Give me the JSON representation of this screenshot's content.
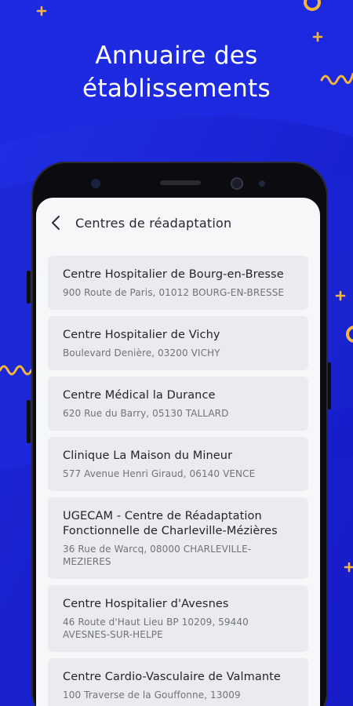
{
  "headline": {
    "line1": "Annuaire des",
    "line2": "établissements"
  },
  "appbar": {
    "back_icon": "chevron-left-icon",
    "title": "Centres de réadaptation"
  },
  "establishments": [
    {
      "name": "Centre Hospitalier de Bourg-en-Bresse",
      "address": "900 Route de Paris, 01012 BOURG-EN-BRESSE"
    },
    {
      "name": "Centre Hospitalier de Vichy",
      "address": "Boulevard Denière, 03200 VICHY"
    },
    {
      "name": "Centre Médical la Durance",
      "address": "620 Rue du Barry, 05130 TALLARD"
    },
    {
      "name": "Clinique La Maison du Mineur",
      "address": "577 Avenue Henri Giraud, 06140 VENCE"
    },
    {
      "name": "UGECAM - Centre de Réadaptation Fonctionnelle de Charleville-Mézières",
      "address": "36 Rue de Warcq, 08000 CHARLEVILLE-MEZIERES"
    },
    {
      "name": "Centre Hospitalier d'Avesnes",
      "address": "46 Route d'Haut Lieu BP 10209, 59440 AVESNES-SUR-HELPE"
    },
    {
      "name": "Centre Cardio-Vasculaire de Valmante",
      "address": "100 Traverse de la Gouffonne, 13009"
    }
  ],
  "colors": {
    "background": "#1a22d8",
    "accent_decoration": "#f5b53b",
    "screen": "#f6f7f8",
    "card": "#e9ebee"
  }
}
